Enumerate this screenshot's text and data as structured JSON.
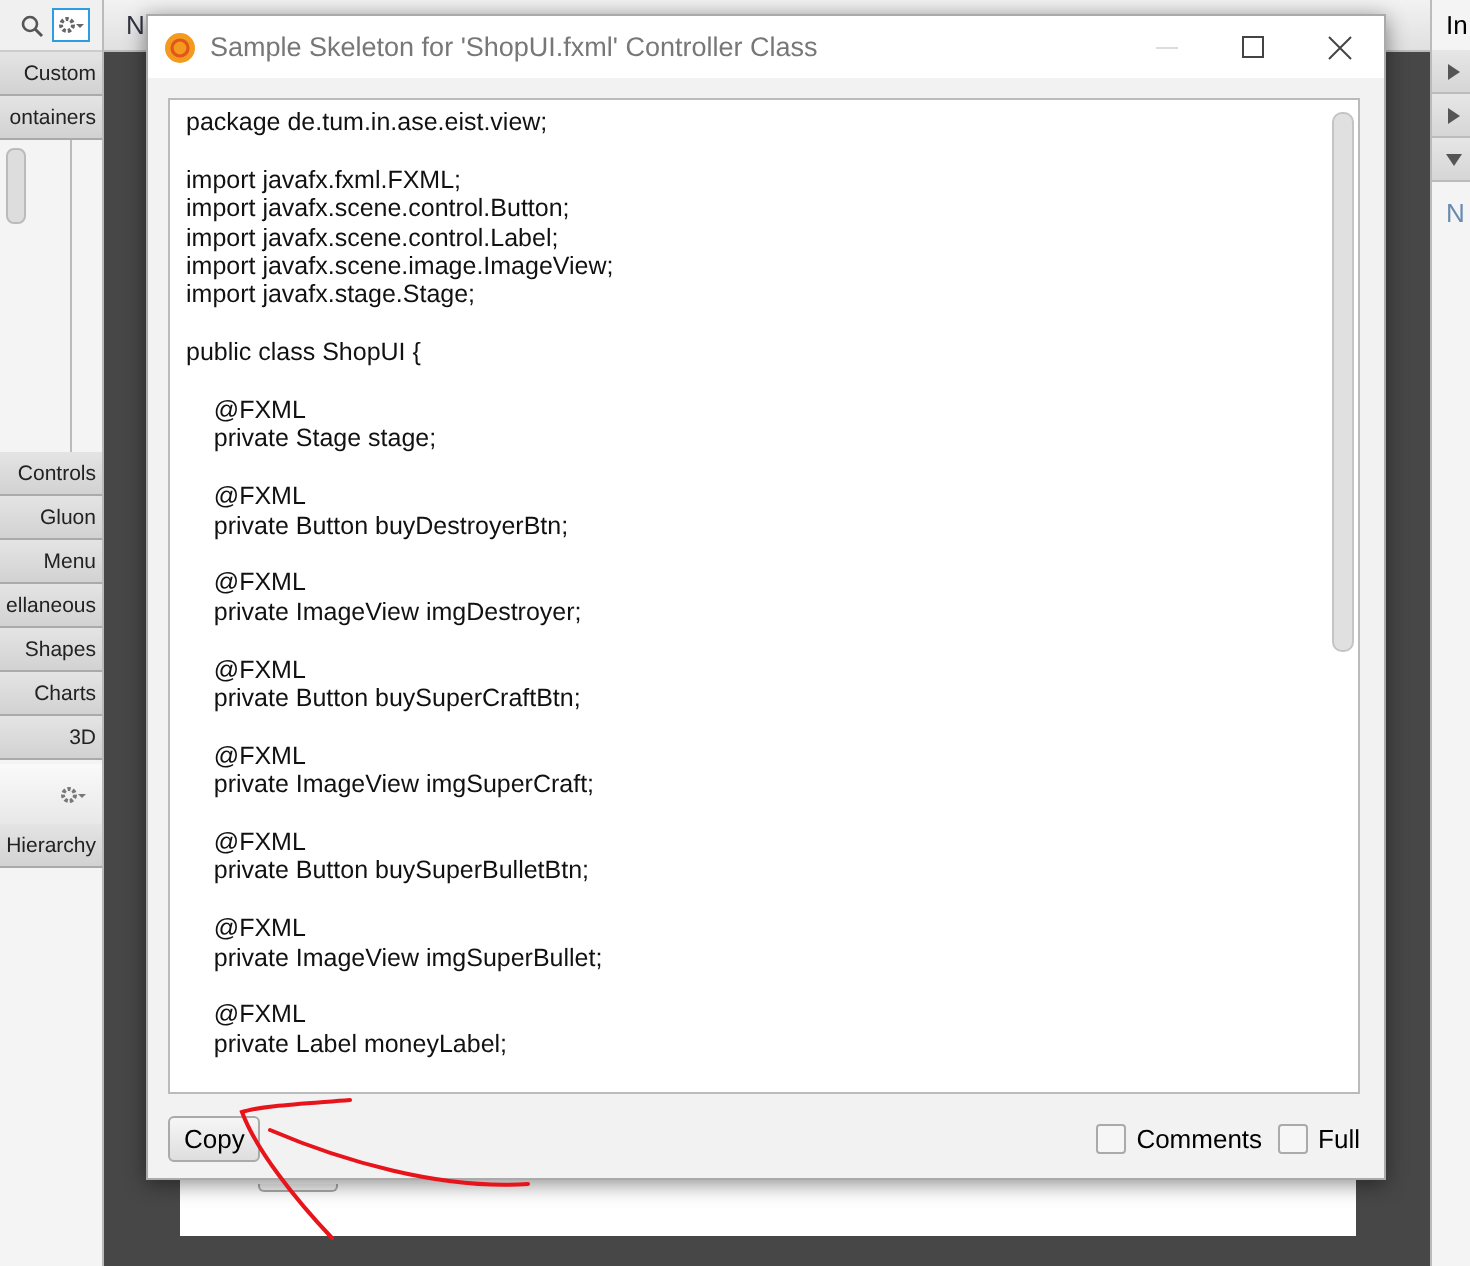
{
  "app": {
    "left_panel": {
      "sections": [
        {
          "label": "Custom",
          "expanded": false
        },
        {
          "label": "ontainers",
          "expanded": true
        },
        {
          "label": "Controls",
          "expanded": false
        },
        {
          "label": "Gluon",
          "expanded": false
        },
        {
          "label": "Menu",
          "expanded": false
        },
        {
          "label": "ellaneous",
          "expanded": false
        },
        {
          "label": "Shapes",
          "expanded": false
        },
        {
          "label": "Charts",
          "expanded": false
        },
        {
          "label": "3D",
          "expanded": false
        }
      ],
      "hierarchy": "Hierarchy"
    },
    "center": {
      "header": "N"
    },
    "right_panel": {
      "header": "In",
      "rows": [
        {
          "expanded": false
        },
        {
          "expanded": false
        },
        {
          "expanded": true
        }
      ],
      "text": "N"
    }
  },
  "dialog": {
    "title": "Sample Skeleton for 'ShopUI.fxml' Controller Class",
    "code_blocks": [
      [
        "package de.tum.in.ase.eist.view;"
      ],
      [
        "import javafx.fxml.FXML;",
        "import javafx.scene.control.Button;",
        "import javafx.scene.control.Label;",
        "import javafx.scene.image.ImageView;",
        "import javafx.stage.Stage;"
      ],
      [
        "public class ShopUI {"
      ],
      [
        "    @FXML",
        "    private Stage stage;"
      ],
      [
        "    @FXML",
        "    private Button buyDestroyerBtn;"
      ],
      [
        "    @FXML",
        "    private ImageView imgDestroyer;"
      ],
      [
        "    @FXML",
        "    private Button buySuperCraftBtn;"
      ],
      [
        "    @FXML",
        "    private ImageView imgSuperCraft;"
      ],
      [
        "    @FXML",
        "    private Button buySuperBulletBtn;"
      ],
      [
        "    @FXML",
        "    private ImageView imgSuperBullet;"
      ],
      [
        "    @FXML",
        "    private Label moneyLabel;"
      ]
    ],
    "copy_button": "Copy",
    "options": [
      {
        "label": "Comments",
        "checked": false
      },
      {
        "label": "Full",
        "checked": false
      }
    ]
  }
}
